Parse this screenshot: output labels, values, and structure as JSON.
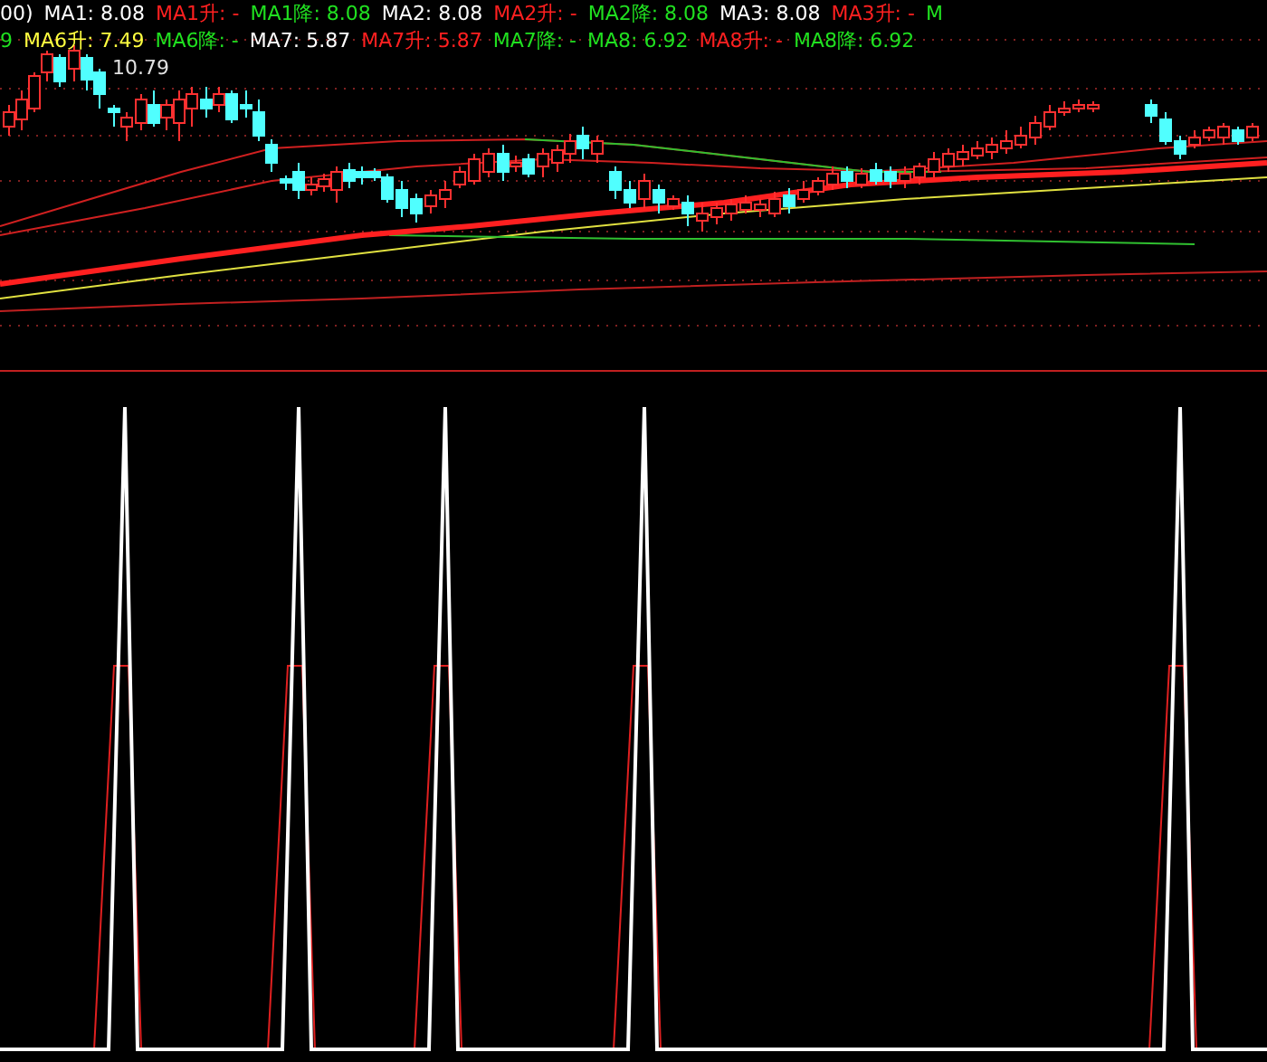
{
  "legend_rows": [
    {
      "items": [
        {
          "text": "00)",
          "color": "#ffffff"
        },
        {
          "text": "MA1: 8.08",
          "color": "#ffffff"
        },
        {
          "text": "MA1升: -",
          "color": "#ff2020"
        },
        {
          "text": "MA1降: 8.08",
          "color": "#20e020"
        },
        {
          "text": "MA2: 8.08",
          "color": "#ffffff"
        },
        {
          "text": "MA2升: -",
          "color": "#ff2020"
        },
        {
          "text": "MA2降: 8.08",
          "color": "#20e020"
        },
        {
          "text": "MA3: 8.08",
          "color": "#ffffff"
        },
        {
          "text": "MA3升: -",
          "color": "#ff2020"
        },
        {
          "text": "M",
          "color": "#20e020"
        }
      ]
    },
    {
      "items": [
        {
          "text": "9",
          "color": "#20e020"
        },
        {
          "text": "MA6升: 7.49",
          "color": "#ffff40"
        },
        {
          "text": "MA6降: -",
          "color": "#20e020"
        },
        {
          "text": "MA7: 5.87",
          "color": "#ffffff"
        },
        {
          "text": "MA7升: 5.87",
          "color": "#ff2020"
        },
        {
          "text": "MA7降: -",
          "color": "#20e020"
        },
        {
          "text": "MA8: 6.92",
          "color": "#20e020"
        },
        {
          "text": "MA8升: -",
          "color": "#ff2020"
        },
        {
          "text": "MA8降: 6.92",
          "color": "#20e020"
        }
      ]
    }
  ],
  "price_label": "10.79"
}
